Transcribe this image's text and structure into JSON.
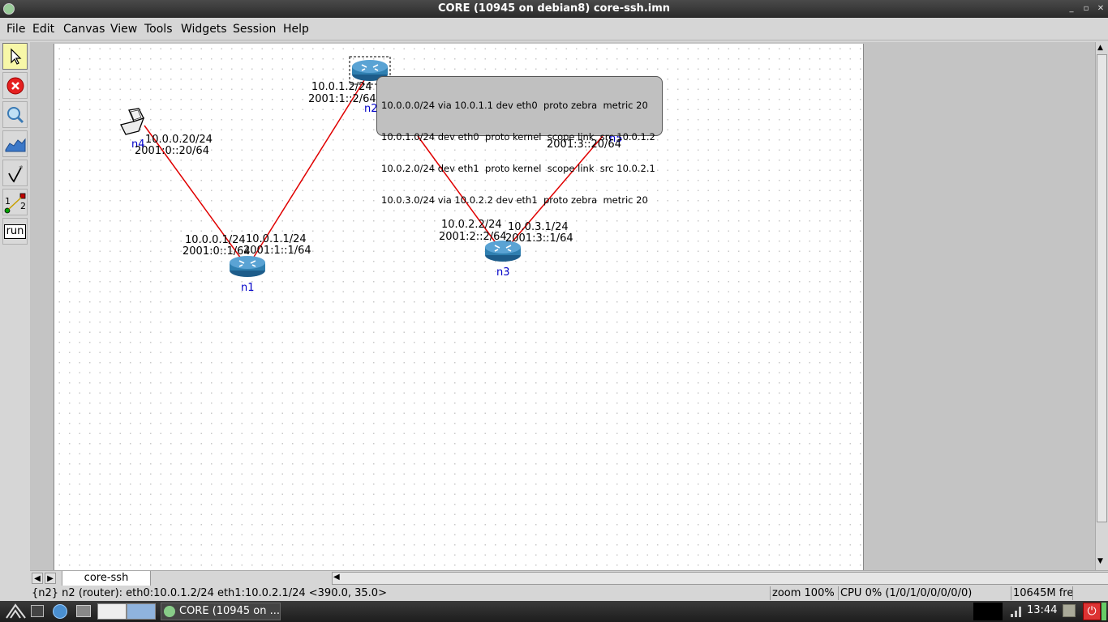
{
  "window": {
    "title": "CORE (10945 on debian8) core-ssh.imn",
    "btn_minimize": "_",
    "btn_maximize": "▫",
    "btn_close": "✕"
  },
  "menu": [
    "File",
    "Edit",
    "Canvas",
    "View",
    "Tools",
    "Widgets",
    "Session",
    "Help"
  ],
  "toolbar": {
    "tools": [
      {
        "icon": "select-arrow-icon",
        "selected": true
      },
      {
        "icon": "stop-icon"
      },
      {
        "icon": "magnifier-icon"
      },
      {
        "icon": "graph-icon"
      },
      {
        "icon": "pen-icon"
      },
      {
        "icon": "link-icon"
      },
      {
        "icon": "run-icon"
      }
    ],
    "link_tool_label_1": "1",
    "link_tool_label_2": "2",
    "run_label": "run"
  },
  "nodes": {
    "n1": {
      "name": "n1",
      "addr_left": "10.0.0.1/24",
      "addr_left6": "2001:0::1/64",
      "addr_right": "10.0.1.1/24",
      "addr_right6": "2001:1::1/64"
    },
    "n2": {
      "name": "n2",
      "addr": "10.0.1.2/24",
      "addr6": "2001:1::2/64"
    },
    "n3": {
      "name": "n3",
      "addr_left": "10.0.2.2/24",
      "addr_left6": "2001:2::2/64",
      "addr_right": "10.0.3.1/24",
      "addr_right6": "2001:3::1/64"
    },
    "n4": {
      "name": "n4",
      "addr": "10.0.0.20/24",
      "addr6": "2001:0::20/64"
    },
    "n5": {
      "name": "n5",
      "addr6": "2001:3::20/64"
    }
  },
  "route_tooltip": [
    "10.0.0.0/24 via 10.0.1.1 dev eth0  proto zebra  metric 20",
    "10.0.1.0/24 dev eth0  proto kernel  scope link  src 10.0.1.2",
    "10.0.2.0/24 dev eth1  proto kernel  scope link  src 10.0.2.1",
    "10.0.3.0/24 via 10.0.2.2 dev eth1  proto zebra  metric 20"
  ],
  "canvas_tab": "core-ssh",
  "status": {
    "info": "{n2} n2 (router): eth0:10.0.1.2/24 eth1:10.0.2.1/24 <390.0, 35.0>",
    "zoom": "zoom 100%",
    "cpu": "CPU 0% (1/0/1/0/0/0/0/0)",
    "mem": "10645M fre"
  },
  "taskbar": {
    "app_label": "CORE (10945 on ...",
    "clock": "13:44"
  },
  "colors": {
    "link": "#e00000",
    "node_label": "#0000c8",
    "router": "#2f7fb0",
    "selected_tool": "#f7f7a8"
  }
}
